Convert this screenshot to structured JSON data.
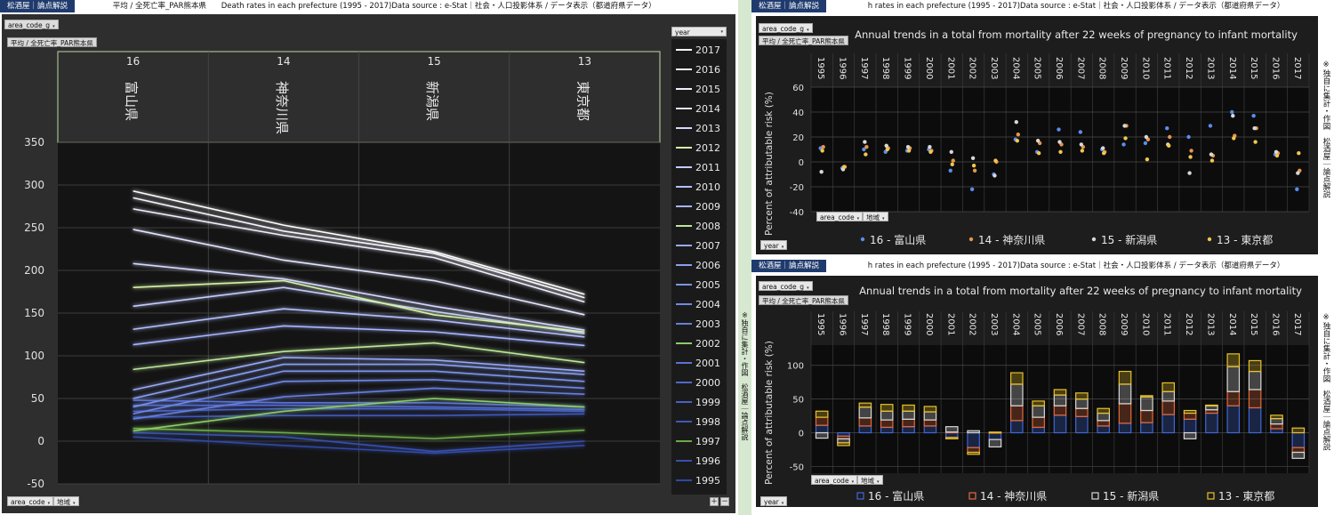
{
  "colors": {
    "bg": "#141414",
    "grid": "#5a5a5a",
    "frame": "#b9d8a6",
    "text": "#dddddd",
    "teal_header": "#1f3b6e"
  },
  "left": {
    "header": {
      "tag": "松酒屋｜論点解説",
      "items": [
        "平均 / 全死亡率_PAR熊本県",
        "Death rates in each prefecture (1995 - 2017)Data source : e-Stat｜社会・人口投影体系 / データ表示（都道府県データ）"
      ]
    },
    "filter_label": "area_code_g",
    "filter_chip": "平均 / 全死亡率_PAR熊本県",
    "bottom_dd": [
      "area_code",
      "地域"
    ],
    "legend_title": "year",
    "plus": "+",
    "minus": "−"
  },
  "right_top": {
    "header": {
      "tag": "松酒屋｜論点解説",
      "items": [
        "h rates in each prefecture (1995 - 2017)Data source : e-Stat｜社会・人口投影体系 / データ表示（都道府県データ）"
      ]
    },
    "filter_label": "area_code_g",
    "filter_chip": "平均 / 全死亡率_PAR熊本県",
    "dd1": "area_code",
    "dd2": "地域",
    "year_dd": "year",
    "side_note": "※独自に集計・作図　松酒屋｜論点解説"
  },
  "right_bottom": {
    "header": {
      "tag": "松酒屋｜論点解説",
      "items": [
        "h rates in each prefecture (1995 - 2017)Data source : e-Stat｜社会・人口投影体系 / データ表示（都道府県データ）"
      ]
    },
    "filter_label": "area_code_g",
    "filter_chip": "平均 / 全死亡率_PAR熊本県",
    "dd1": "area_code",
    "dd2": "地域",
    "year_dd": "year",
    "side_note": "※独自に集計・作図　松酒屋｜論点解説"
  },
  "middle_note": "※独自に集計・作図　松酒屋｜論点解説",
  "chart_data": [
    {
      "type": "line",
      "categories": [
        "16",
        "14",
        "15",
        "13"
      ],
      "category_names": [
        "富山県",
        "神奈川県",
        "新潟県",
        "東京都"
      ],
      "ylim": [
        -50,
        350
      ],
      "yticks": [
        -50,
        0,
        50,
        100,
        150,
        200,
        250,
        300,
        350
      ],
      "legend_title": "year",
      "series": [
        {
          "name": "2017",
          "color": "#ffffff",
          "values": [
            293,
            253,
            222,
            172
          ]
        },
        {
          "name": "2016",
          "color": "#f6f6ff",
          "values": [
            285,
            246,
            220,
            168
          ]
        },
        {
          "name": "2015",
          "color": "#eeeeff",
          "values": [
            272,
            241,
            215,
            163
          ]
        },
        {
          "name": "2014",
          "color": "#e2e4ff",
          "values": [
            248,
            212,
            188,
            148
          ]
        },
        {
          "name": "2013",
          "color": "#d4d8ff",
          "values": [
            208,
            190,
            158,
            130
          ]
        },
        {
          "name": "2012",
          "color": "#d6f4a8",
          "values": [
            180,
            188,
            148,
            128
          ]
        },
        {
          "name": "2011",
          "color": "#c4ccff",
          "values": [
            158,
            180,
            152,
            126
          ]
        },
        {
          "name": "2010",
          "color": "#b4c0ff",
          "values": [
            131,
            155,
            142,
            122
          ]
        },
        {
          "name": "2009",
          "color": "#a6b6ff",
          "values": [
            113,
            135,
            128,
            112
          ]
        },
        {
          "name": "2008",
          "color": "#bce69a",
          "values": [
            84,
            105,
            115,
            92
          ]
        },
        {
          "name": "2007",
          "color": "#98aaf5",
          "values": [
            60,
            98,
            95,
            82
          ]
        },
        {
          "name": "2006",
          "color": "#8aa0f0",
          "values": [
            50,
            90,
            90,
            78
          ]
        },
        {
          "name": "2005",
          "color": "#7c94ea",
          "values": [
            40,
            82,
            82,
            70
          ]
        },
        {
          "name": "2004",
          "color": "#7088e4",
          "values": [
            32,
            70,
            72,
            62
          ]
        },
        {
          "name": "2003",
          "color": "#667edd",
          "values": [
            26,
            52,
            62,
            55
          ]
        },
        {
          "name": "2002",
          "color": "#8ccc6a",
          "values": [
            12,
            35,
            50,
            40
          ]
        },
        {
          "name": "2001",
          "color": "#5a72d4",
          "values": [
            48,
            45,
            45,
            40
          ]
        },
        {
          "name": "2000",
          "color": "#5068cc",
          "values": [
            42,
            42,
            40,
            37
          ]
        },
        {
          "name": "1999",
          "color": "#4860c2",
          "values": [
            35,
            38,
            38,
            35
          ]
        },
        {
          "name": "1998",
          "color": "#4058b8",
          "values": [
            28,
            30,
            30,
            32
          ]
        },
        {
          "name": "1997",
          "color": "#6aaa48",
          "values": [
            15,
            10,
            3,
            13
          ]
        },
        {
          "name": "1996",
          "color": "#3850ae",
          "values": [
            10,
            5,
            -12,
            0
          ]
        },
        {
          "name": "1995",
          "color": "#3048a4",
          "values": [
            5,
            -5,
            -14,
            -5
          ]
        }
      ]
    },
    {
      "type": "scatter",
      "title": "Annual trends in a total from mortality after 22 weeks of pregnancy to infant mortality",
      "ylabel": "Percent of attributable risk (%)",
      "ylim": [
        -40,
        60
      ],
      "yticks": [
        -40,
        -20,
        0,
        20,
        40,
        60
      ],
      "categories": [
        "1995",
        "1996",
        "1997",
        "1998",
        "1999",
        "2000",
        "2001",
        "2002",
        "2003",
        "2004",
        "2005",
        "2006",
        "2007",
        "2008",
        "2009",
        "2010",
        "2011",
        "2012",
        "2013",
        "2014",
        "2015",
        "2016",
        "2017"
      ],
      "series": [
        {
          "name": "16 - 富山県",
          "color": "#5b8def",
          "values": [
            11,
            -5,
            10,
            8,
            9,
            10,
            -7,
            -22,
            -10,
            18,
            8,
            26,
            24,
            10,
            14,
            15,
            27,
            20,
            29,
            40,
            37,
            6,
            -22
          ]
        },
        {
          "name": "14 - 神奈川県",
          "color": "#e8954a",
          "values": [
            12,
            -4,
            12,
            11,
            11,
            9,
            1,
            -7,
            0,
            22,
            15,
            14,
            12,
            8,
            29,
            18,
            20,
            9,
            5,
            21,
            27,
            7,
            -7
          ]
        },
        {
          "name": "15 - 新潟県",
          "color": "#d8d8d8",
          "values": [
            -8,
            -6,
            16,
            13,
            12,
            12,
            8,
            3,
            -11,
            32,
            17,
            16,
            14,
            11,
            29,
            20,
            14,
            -9,
            6,
            37,
            27,
            8,
            -9
          ]
        },
        {
          "name": "13 - 東京都",
          "color": "#f0c84a",
          "values": [
            9,
            -4,
            6,
            10,
            9,
            8,
            -2,
            -3,
            1,
            17,
            7,
            8,
            9,
            7,
            19,
            2,
            13,
            4,
            1,
            19,
            16,
            5,
            7
          ]
        }
      ]
    },
    {
      "type": "bar",
      "title": "Annual trends in a total from mortality after 22 weeks of pregnancy to infant mortality",
      "ylabel": "Percent of attributable risk (%)",
      "ylim": [
        -60,
        130
      ],
      "yticks": [
        -50,
        0,
        50,
        100
      ],
      "categories": [
        "1995",
        "1996",
        "1997",
        "1998",
        "1999",
        "2000",
        "2001",
        "2002",
        "2003",
        "2004",
        "2005",
        "2006",
        "2007",
        "2008",
        "2009",
        "2010",
        "2011",
        "2012",
        "2013",
        "2014",
        "2015",
        "2016",
        "2017"
      ],
      "series": [
        {
          "name": "16 - 富山県",
          "color": "#3f67d6",
          "values": [
            11,
            -5,
            10,
            8,
            9,
            10,
            -7,
            -22,
            -10,
            18,
            8,
            26,
            24,
            10,
            14,
            15,
            27,
            20,
            29,
            40,
            37,
            6,
            -22
          ]
        },
        {
          "name": "14 - 神奈川県",
          "color": "#e36a3c",
          "values": [
            12,
            -4,
            12,
            11,
            11,
            9,
            1,
            -7,
            0,
            22,
            15,
            14,
            12,
            8,
            29,
            18,
            20,
            9,
            5,
            21,
            27,
            7,
            -7
          ]
        },
        {
          "name": "15 - 新潟県",
          "color": "#d8d8d8",
          "values": [
            -8,
            -6,
            16,
            13,
            12,
            12,
            8,
            3,
            -11,
            32,
            17,
            16,
            14,
            11,
            29,
            20,
            14,
            -9,
            6,
            37,
            27,
            8,
            -9
          ]
        },
        {
          "name": "13 - 東京都",
          "color": "#e8c22a",
          "values": [
            9,
            -4,
            6,
            10,
            9,
            8,
            -2,
            -3,
            1,
            17,
            7,
            8,
            9,
            7,
            19,
            2,
            13,
            4,
            1,
            19,
            16,
            5,
            7
          ]
        }
      ]
    }
  ]
}
